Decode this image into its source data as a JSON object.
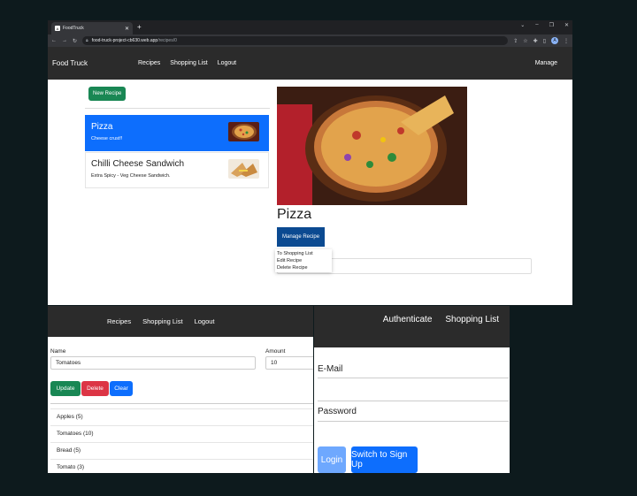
{
  "browser": {
    "tab_title": "FoodTruck",
    "tab_favicon": "A",
    "tab_close": "✕",
    "new_tab": "+",
    "window_controls": [
      "⌄",
      "–",
      "❐",
      "✕"
    ],
    "url_host": "food-truck-project-cb630.web.app",
    "url_path": "/recipes/0",
    "avatar_letter": "A"
  },
  "app": {
    "brand": "Food Truck",
    "nav": [
      "Recipes",
      "Shopping List",
      "Logout"
    ],
    "manage": "Manage"
  },
  "recipes": {
    "new_button": "New Recipe",
    "items": [
      {
        "name": "Pizza",
        "description": "Cheese crust!!"
      },
      {
        "name": "Chilli Cheese Sandwich",
        "description": "Extra Spicy - Veg Cheese Sandwich."
      }
    ]
  },
  "detail": {
    "title": "Pizza",
    "manage_button": "Manage Recipe",
    "menu": [
      "To Shopping List",
      "Edit Recipe",
      "Delete Recipe"
    ]
  },
  "shopping": {
    "nav": [
      "Recipes",
      "Shopping List",
      "Logout"
    ],
    "name_label": "Name",
    "name_value": "Tomatoes",
    "amount_label": "Amount",
    "amount_value": "10",
    "buttons": {
      "update": "Update",
      "delete": "Delete",
      "clear": "Clear"
    },
    "ingredients": [
      "Apples (5)",
      "Tomatoes (10)",
      "Bread (5)",
      "Tomato (3)"
    ]
  },
  "auth": {
    "nav": [
      "Authenticate",
      "Shopping List"
    ],
    "email_label": "E-Mail",
    "password_label": "Password",
    "login_button": "Login",
    "switch_button": "Switch to Sign Up"
  },
  "colors": {
    "success": "#198754",
    "primary": "#0d6efd",
    "danger": "#dc3545",
    "navbar": "#2b2b2b"
  }
}
